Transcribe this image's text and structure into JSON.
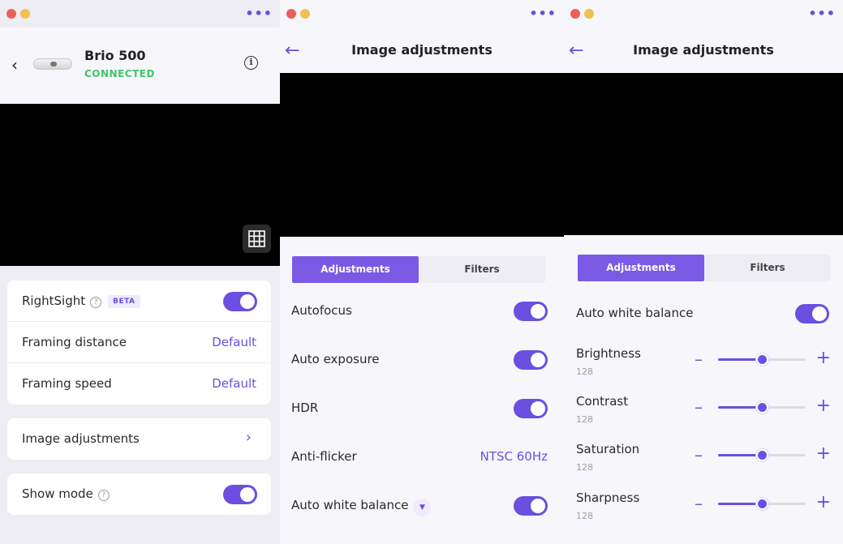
{
  "colors": {
    "accent": "#6a4fe0",
    "connected": "#3fc56b",
    "preview": "#000000"
  },
  "panel1": {
    "device": {
      "name": "Brio 500",
      "status": "CONNECTED"
    },
    "icons": {
      "back": "chevron-left-icon",
      "info": "info-icon",
      "grid": "grid-icon",
      "more": "more-dots-icon"
    },
    "rightsight": {
      "label": "RightSight",
      "badge": "BETA",
      "toggle_on": true
    },
    "framing_distance": {
      "label": "Framing distance",
      "value": "Default"
    },
    "framing_speed": {
      "label": "Framing speed",
      "value": "Default"
    },
    "image_adjustments": {
      "label": "Image adjustments"
    },
    "show_mode": {
      "label": "Show mode",
      "toggle_on": true
    }
  },
  "panel2": {
    "title": "Image adjustments",
    "tabs": [
      "Adjustments",
      "Filters"
    ],
    "active_tab": "Adjustments",
    "settings": [
      {
        "label": "Autofocus",
        "type": "toggle",
        "on": true
      },
      {
        "label": "Auto exposure",
        "type": "toggle",
        "on": true
      },
      {
        "label": "HDR",
        "type": "toggle",
        "on": true
      },
      {
        "label": "Anti-flicker",
        "type": "value",
        "value": "NTSC 60Hz"
      },
      {
        "label": "Auto white balance",
        "type": "toggle",
        "on": true
      }
    ]
  },
  "panel3": {
    "title": "Image adjustments",
    "tabs": [
      "Adjustments",
      "Filters"
    ],
    "active_tab": "Adjustments",
    "auto_white_balance": {
      "label": "Auto white balance",
      "on": true
    },
    "sliders": [
      {
        "label": "Brightness",
        "value": "128",
        "fraction": 0.5
      },
      {
        "label": "Contrast",
        "value": "128",
        "fraction": 0.5
      },
      {
        "label": "Saturation",
        "value": "128",
        "fraction": 0.5
      },
      {
        "label": "Sharpness",
        "value": "128",
        "fraction": 0.5
      }
    ]
  }
}
